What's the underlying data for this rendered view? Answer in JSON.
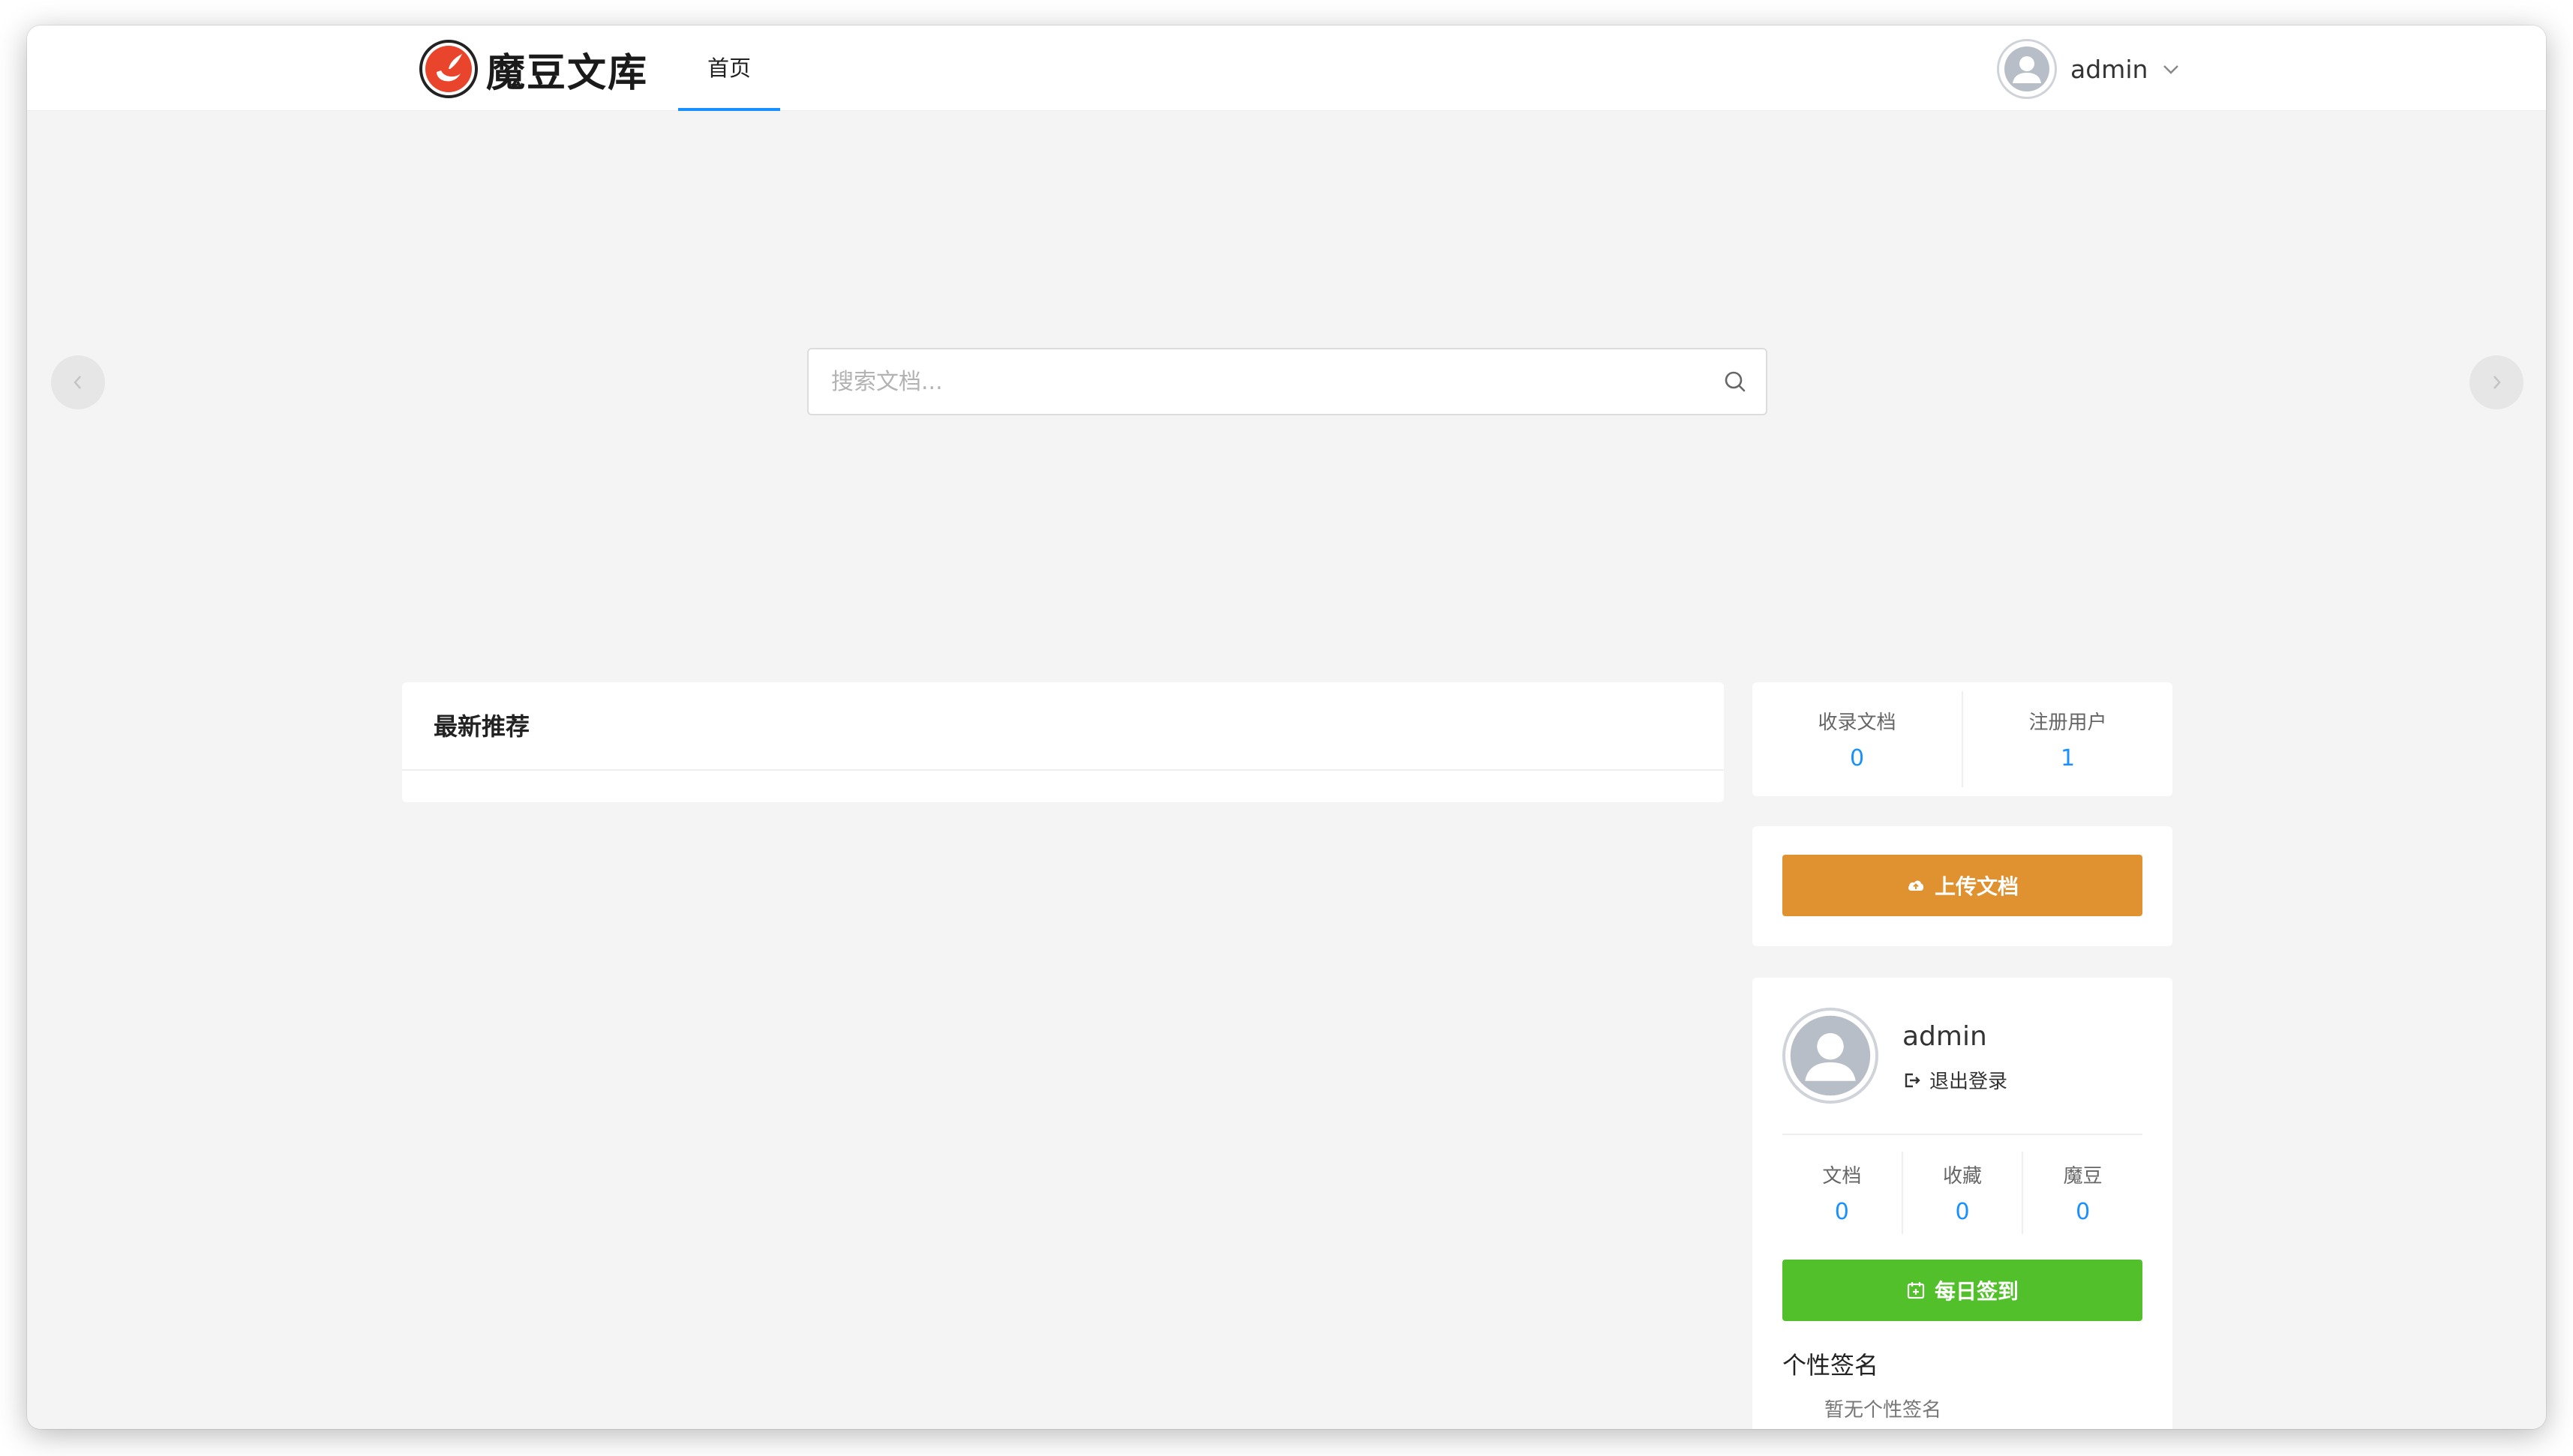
{
  "header": {
    "logo_text": "魔豆文库",
    "nav_home": "首页",
    "username": "admin"
  },
  "search": {
    "placeholder": "搜索文档..."
  },
  "latest": {
    "title": "最新推荐"
  },
  "site_stats": {
    "docs_label": "收录文档",
    "docs_value": "0",
    "users_label": "注册用户",
    "users_value": "1"
  },
  "upload": {
    "label": "上传文档"
  },
  "profile": {
    "name": "admin",
    "logout_label": "退出登录",
    "stats": [
      {
        "label": "文档",
        "value": "0"
      },
      {
        "label": "收藏",
        "value": "0"
      },
      {
        "label": "魔豆",
        "value": "0"
      }
    ],
    "checkin_label": "每日签到",
    "signature_title": "个性签名",
    "signature_text": "暂无个性签名"
  },
  "colors": {
    "accent": "#1890ff",
    "upload": "#e19230",
    "checkin": "#52c02a",
    "logo_red": "#e8452c"
  }
}
